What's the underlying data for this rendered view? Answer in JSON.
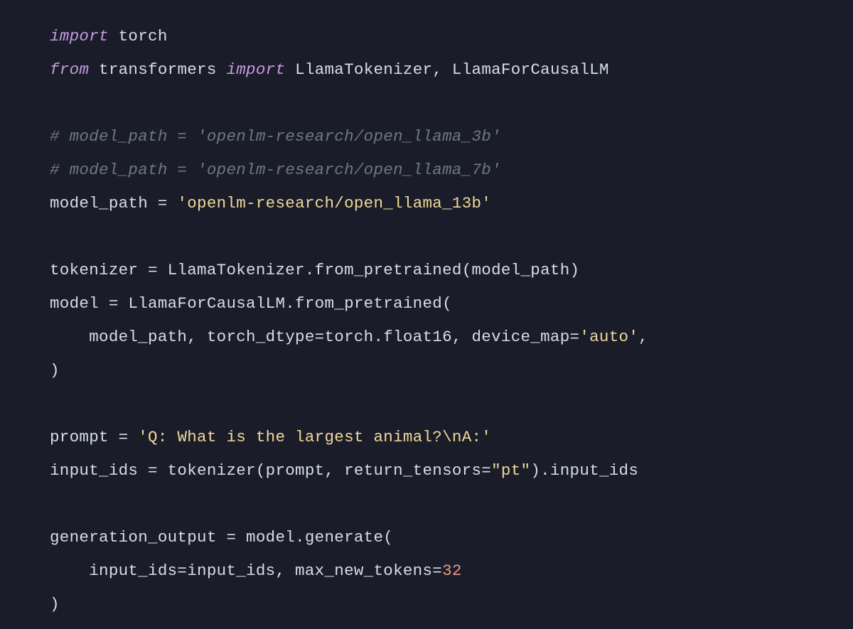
{
  "code": {
    "l1": {
      "k1": "import",
      "t1": " torch"
    },
    "l2": {
      "k1": "from",
      "t1": " transformers ",
      "k2": "import",
      "t2": " LlamaTokenizer, LlamaForCausalLM"
    },
    "l3": "",
    "l4": "# model_path = 'openlm-research/open_llama_3b'",
    "l5": "# model_path = 'openlm-research/open_llama_7b'",
    "l6": {
      "t1": "model_path = ",
      "s1": "'openlm-research/open_llama_13b'"
    },
    "l7": "",
    "l8": "tokenizer = LlamaTokenizer.from_pretrained(model_path)",
    "l9": "model = LlamaForCausalLM.from_pretrained(",
    "l10": {
      "t1": "    model_path, torch_dtype=torch.float16, device_map=",
      "s1": "'auto'",
      "t2": ","
    },
    "l11": ")",
    "l12": "",
    "l13": {
      "t1": "prompt = ",
      "s1": "'Q: What is the largest animal?\\nA:'"
    },
    "l14": {
      "t1": "input_ids = tokenizer(prompt, return_tensors=",
      "s1": "\"pt\"",
      "t2": ").input_ids"
    },
    "l15": "",
    "l16": "generation_output = model.generate(",
    "l17": {
      "t1": "    input_ids=input_ids, max_new_tokens=",
      "n1": "32"
    },
    "l18": ")"
  }
}
